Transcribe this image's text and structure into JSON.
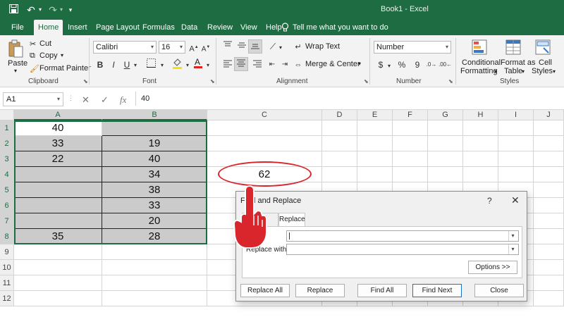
{
  "title_bar": {
    "document_title": "Book1  -  Excel",
    "icons": [
      "save-icon",
      "undo-icon",
      "undo-dropdown-icon",
      "redo-icon",
      "redo-dropdown-icon",
      "customize-icon"
    ]
  },
  "ribbon_tabs": [
    "File",
    "Home",
    "Insert",
    "Page Layout",
    "Formulas",
    "Data",
    "Review",
    "View",
    "Help"
  ],
  "active_tab": "Home",
  "tell_me": "Tell me what you want to do",
  "ribbon": {
    "clipboard": {
      "paste": "Paste",
      "cut": "Cut",
      "copy": "Copy",
      "format_painter": "Format Painter",
      "label": "Clipboard"
    },
    "font": {
      "name": "Calibri",
      "size": "16",
      "bold": "B",
      "italic": "I",
      "underline": "U",
      "label": "Font"
    },
    "alignment": {
      "wrap_text": "Wrap Text",
      "merge_center": "Merge & Center",
      "label": "Alignment"
    },
    "number": {
      "format": "Number",
      "currency": "$",
      "percent": "%",
      "comma": "9",
      "label": "Number"
    },
    "styles": {
      "conditional": "Conditional",
      "formatting": "Formatting",
      "format_as": "Format as",
      "table": "Table",
      "cell": "Cell",
      "styles_word": "Styles",
      "label": "Styles"
    }
  },
  "formula_bar": {
    "name_box": "A1",
    "fx": "fx",
    "value": "40"
  },
  "columns": [
    "A",
    "B",
    "C",
    "D",
    "E",
    "F",
    "G",
    "H",
    "I",
    "J"
  ],
  "rows": [
    "1",
    "2",
    "3",
    "4",
    "5",
    "6",
    "7",
    "8",
    "9",
    "10",
    "11",
    "12"
  ],
  "cells": {
    "A1": "40",
    "A2": "33",
    "A3": "22",
    "A8": "35",
    "B2": "19",
    "B3": "40",
    "B4": "34",
    "B5": "38",
    "B6": "33",
    "B7": "20",
    "B8": "28",
    "C4": "62"
  },
  "dialog": {
    "title": "Find and Replace",
    "help": "?",
    "close": "✕",
    "tab_find": "Find",
    "tab_replace": "Replace",
    "replace_with_label": "Replace with:",
    "find_value": "",
    "replace_value": "",
    "options": "Options >>",
    "buttons": [
      "Replace All",
      "Replace",
      "Find All",
      "Find Next",
      "Close"
    ]
  },
  "annotation": {
    "oval_color": "#d8262c",
    "hand_color": "#d8262c"
  },
  "colors": {
    "excel_green": "#1e6d42",
    "selection_fill": "#cbcbcb"
  }
}
